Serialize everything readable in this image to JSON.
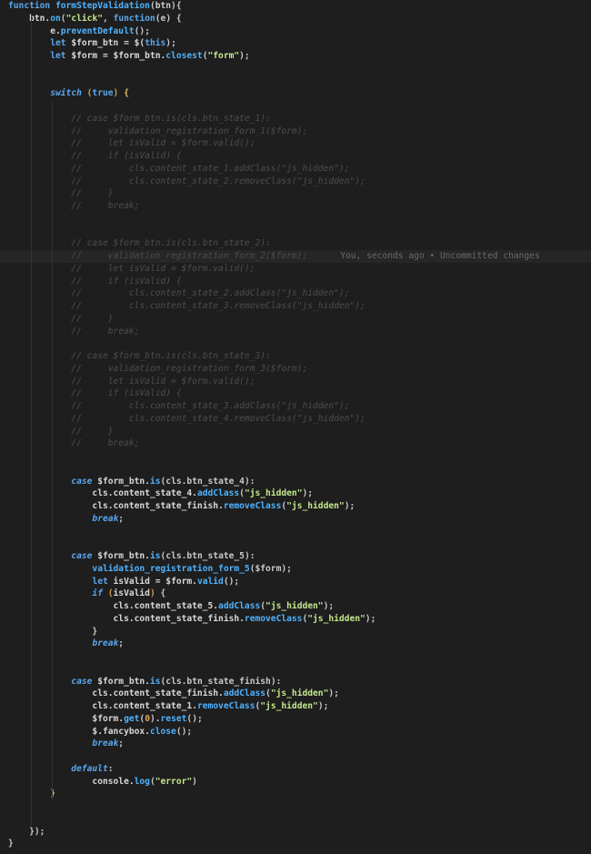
{
  "editor": {
    "blame": "You, seconds ago • Uncommitted changes",
    "lines": [
      [
        [
          "kw",
          "function "
        ],
        [
          "fn",
          "formStepValidation"
        ],
        [
          "punc",
          "(btn){"
        ]
      ],
      [
        [
          "plain",
          "    btn."
        ],
        [
          "fn",
          "on"
        ],
        [
          "punc",
          "("
        ],
        [
          "str",
          "\"click\""
        ],
        [
          "punc",
          ", "
        ],
        [
          "kw",
          "function"
        ],
        [
          "punc",
          "(e) {"
        ]
      ],
      [
        [
          "plain",
          "        e."
        ],
        [
          "fn",
          "preventDefault"
        ],
        [
          "punc",
          "();"
        ]
      ],
      [
        [
          "kw",
          "        let "
        ],
        [
          "plain",
          "$form_btn = $("
        ],
        [
          "kw",
          "this"
        ],
        [
          "punc",
          ");"
        ]
      ],
      [
        [
          "kw",
          "        let "
        ],
        [
          "plain",
          "$form = $form_btn."
        ],
        [
          "fn",
          "closest"
        ],
        [
          "punc",
          "("
        ],
        [
          "str",
          "\"form\""
        ],
        [
          "punc",
          ");"
        ]
      ],
      [],
      [],
      [
        [
          "ctl",
          "        switch "
        ],
        [
          "paren",
          "("
        ],
        [
          "kw",
          "true"
        ],
        [
          "paren",
          ")"
        ],
        [
          "brk",
          " {"
        ]
      ],
      [],
      [
        [
          "cm",
          "            // case $form_btn.is(cls.btn_state_1):"
        ]
      ],
      [
        [
          "cm",
          "            //     validation_registration_form_1($form);"
        ]
      ],
      [
        [
          "cm",
          "            //     let isValid = $form.valid();"
        ]
      ],
      [
        [
          "cm",
          "            //     if (isValid) {"
        ]
      ],
      [
        [
          "cm",
          "            //         cls.content_state_1.addClass(\"js_hidden\");"
        ]
      ],
      [
        [
          "cm",
          "            //         cls.content_state_2.removeClass(\"js_hidden\");"
        ]
      ],
      [
        [
          "cm",
          "            //     }"
        ]
      ],
      [
        [
          "cm",
          "            //     break;"
        ]
      ],
      [],
      [],
      [
        [
          "cm",
          "            // case $form_btn.is(cls.btn_state_2):"
        ]
      ],
      [
        [
          "cm",
          "            //     validation_registration_form_2($form);"
        ]
      ],
      [
        [
          "cm",
          "            //     let isValid = $form.valid();"
        ]
      ],
      [
        [
          "cm",
          "            //     if (isValid) {"
        ]
      ],
      [
        [
          "cm",
          "            //         cls.content_state_2.addClass(\"js_hidden\");"
        ]
      ],
      [
        [
          "cm",
          "            //         cls.content_state_3.removeClass(\"js_hidden\");"
        ]
      ],
      [
        [
          "cm",
          "            //     }"
        ]
      ],
      [
        [
          "cm",
          "            //     break;"
        ]
      ],
      [],
      [
        [
          "cm",
          "            // case $form_btn.is(cls.btn_state_3):"
        ]
      ],
      [
        [
          "cm",
          "            //     validation_registration_form_3($form);"
        ]
      ],
      [
        [
          "cm",
          "            //     let isValid = $form.valid();"
        ]
      ],
      [
        [
          "cm",
          "            //     if (isValid) {"
        ]
      ],
      [
        [
          "cm",
          "            //         cls.content_state_3.addClass(\"js_hidden\");"
        ]
      ],
      [
        [
          "cm",
          "            //         cls.content_state_4.removeClass(\"js_hidden\");"
        ]
      ],
      [
        [
          "cm",
          "            //     }"
        ]
      ],
      [
        [
          "cm",
          "            //     break;"
        ]
      ],
      [],
      [],
      [
        [
          "ctl",
          "            case "
        ],
        [
          "plain",
          "$form_btn."
        ],
        [
          "fn",
          "is"
        ],
        [
          "punc",
          "(cls.btn_state_4):"
        ]
      ],
      [
        [
          "plain",
          "                cls.content_state_4."
        ],
        [
          "fn",
          "addClass"
        ],
        [
          "punc",
          "("
        ],
        [
          "str",
          "\"js_hidden\""
        ],
        [
          "punc",
          ");"
        ]
      ],
      [
        [
          "plain",
          "                cls.content_state_finish."
        ],
        [
          "fn",
          "removeClass"
        ],
        [
          "punc",
          "("
        ],
        [
          "str",
          "\"js_hidden\""
        ],
        [
          "punc",
          ");"
        ]
      ],
      [
        [
          "ctl",
          "                break"
        ],
        [
          "punc",
          ";"
        ]
      ],
      [],
      [],
      [
        [
          "ctl",
          "            case "
        ],
        [
          "plain",
          "$form_btn."
        ],
        [
          "fn",
          "is"
        ],
        [
          "punc",
          "(cls.btn_state_5):"
        ]
      ],
      [
        [
          "fn",
          "                validation_registration_form_5"
        ],
        [
          "punc",
          "($form);"
        ]
      ],
      [
        [
          "kw",
          "                let "
        ],
        [
          "plain",
          "isValid = $form."
        ],
        [
          "fn",
          "valid"
        ],
        [
          "punc",
          "();"
        ]
      ],
      [
        [
          "ctl",
          "                if "
        ],
        [
          "paren",
          "("
        ],
        [
          "plain",
          "isValid"
        ],
        [
          "paren",
          ")"
        ],
        [
          "punc",
          " {"
        ]
      ],
      [
        [
          "plain",
          "                    cls.content_state_5."
        ],
        [
          "fn",
          "addClass"
        ],
        [
          "punc",
          "("
        ],
        [
          "str",
          "\"js_hidden\""
        ],
        [
          "punc",
          ");"
        ]
      ],
      [
        [
          "plain",
          "                    cls.content_state_finish."
        ],
        [
          "fn",
          "removeClass"
        ],
        [
          "punc",
          "("
        ],
        [
          "str",
          "\"js_hidden\""
        ],
        [
          "punc",
          ");"
        ]
      ],
      [
        [
          "punc",
          "                }"
        ]
      ],
      [
        [
          "ctl",
          "                break"
        ],
        [
          "punc",
          ";"
        ]
      ],
      [],
      [],
      [
        [
          "ctl",
          "            case "
        ],
        [
          "plain",
          "$form_btn."
        ],
        [
          "fn",
          "is"
        ],
        [
          "punc",
          "(cls.btn_state_finish):"
        ]
      ],
      [
        [
          "plain",
          "                cls.content_state_finish."
        ],
        [
          "fn",
          "addClass"
        ],
        [
          "punc",
          "("
        ],
        [
          "str",
          "\"js_hidden\""
        ],
        [
          "punc",
          ");"
        ]
      ],
      [
        [
          "plain",
          "                cls.content_state_1."
        ],
        [
          "fn",
          "removeClass"
        ],
        [
          "punc",
          "("
        ],
        [
          "str",
          "\"js_hidden\""
        ],
        [
          "punc",
          ");"
        ]
      ],
      [
        [
          "plain",
          "                $form."
        ],
        [
          "fn",
          "get"
        ],
        [
          "punc",
          "("
        ],
        [
          "num",
          "0"
        ],
        [
          "punc",
          ")."
        ],
        [
          "fn",
          "reset"
        ],
        [
          "punc",
          "();"
        ]
      ],
      [
        [
          "plain",
          "                $.fancybox."
        ],
        [
          "fn",
          "close"
        ],
        [
          "punc",
          "();"
        ]
      ],
      [
        [
          "ctl",
          "                break"
        ],
        [
          "punc",
          ";"
        ]
      ],
      [],
      [
        [
          "ctl",
          "            default"
        ],
        [
          "punc",
          ":"
        ]
      ],
      [
        [
          "plain",
          "                console."
        ],
        [
          "fn",
          "log"
        ],
        [
          "punc",
          "("
        ],
        [
          "str",
          "\"error\""
        ],
        [
          "punc",
          ")"
        ]
      ],
      [
        [
          "brk",
          "        }"
        ]
      ],
      [],
      [],
      [
        [
          "punc",
          "    });"
        ]
      ],
      [
        [
          "punc",
          "}"
        ]
      ]
    ],
    "current_line": 20,
    "guides": [
      {
        "col": 4,
        "from": 1,
        "to": 65
      },
      {
        "col": 8,
        "from": 8,
        "to": 63
      }
    ]
  }
}
